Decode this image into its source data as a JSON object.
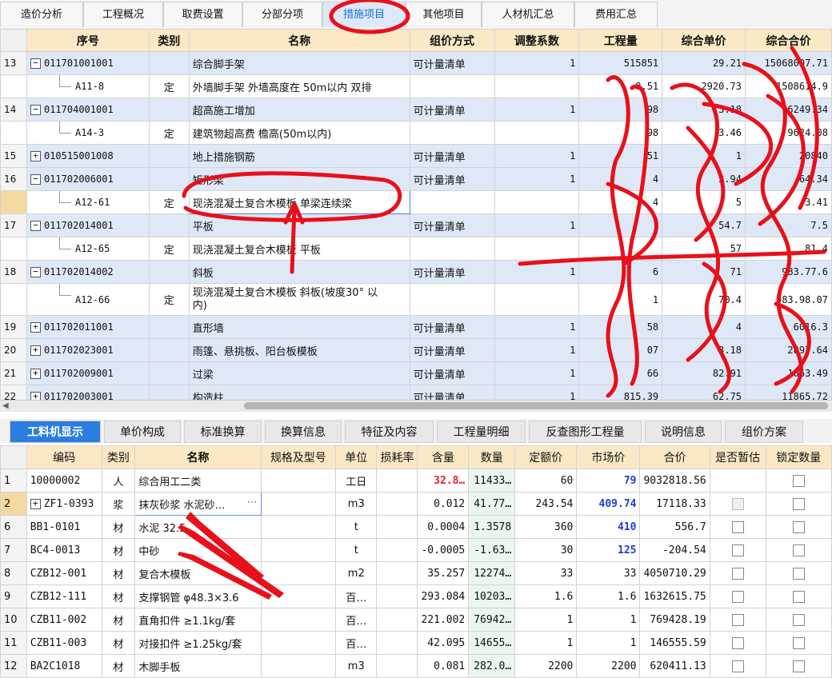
{
  "top_tabs": [
    "造价分析",
    "工程概况",
    "取费设置",
    "分部分项",
    "措施项目",
    "其他项目",
    "人材机汇总",
    "费用汇总"
  ],
  "active_top_tab": 4,
  "grid1": {
    "headers": [
      "序号",
      "类别",
      "名称",
      "组价方式",
      "调整系数",
      "工程量",
      "综合单价",
      "综合合价"
    ],
    "rows": [
      {
        "rn": "13",
        "exp": "−",
        "code": "011701001001",
        "type": "",
        "name": "综合脚手架",
        "method": "可计量清单",
        "coef": "1",
        "qty": "515851",
        "price": "29.21",
        "total": "15068007.71",
        "kind": "parent"
      },
      {
        "rn": "",
        "exp": "",
        "code": "A11-8",
        "type": "定",
        "name": "外墙脚手架 外墙高度在 50m以内 双排",
        "method": "",
        "coef": "",
        "qty": "8.51",
        "price": "2920.73",
        "total": "1508614.9",
        "kind": "child"
      },
      {
        "rn": "14",
        "exp": "−",
        "code": "011704001001",
        "type": "",
        "name": "超高施工增加",
        "method": "可计量清单",
        "coef": "1",
        "qty": "98",
        "price": "3.18",
        "total": "96249.34",
        "kind": "parent"
      },
      {
        "rn": "",
        "exp": "",
        "code": "A14-3",
        "type": "定",
        "name": "建筑物超高费 檐高(50m以内)",
        "method": "",
        "coef": "",
        "qty": "98",
        "price": "3.46",
        "total": "9624.08",
        "kind": "child"
      },
      {
        "rn": "15",
        "exp": "+",
        "code": "010515001008",
        "type": "",
        "name": "地上措施钢筋",
        "method": "可计量清单",
        "coef": "1",
        "qty": "51",
        "price": "1",
        "total": "20840",
        "kind": "parent"
      },
      {
        "rn": "16",
        "exp": "−",
        "code": "011702006001",
        "type": "",
        "name": "矩形梁",
        "method": "可计量清单",
        "coef": "1",
        "qty": "4",
        "price": "3.94",
        "total": "64.34",
        "kind": "parent"
      },
      {
        "rn": "",
        "exp": "",
        "code": "A12-61",
        "type": "定",
        "name": "现浇混凝土复合木模板 单梁连续梁",
        "method": "",
        "coef": "",
        "qty": "4",
        "price": "5",
        "total": "3.41",
        "kind": "sel"
      },
      {
        "rn": "17",
        "exp": "−",
        "code": "011702014001",
        "type": "",
        "name": "平板",
        "method": "可计量清单",
        "coef": "1",
        "qty": "",
        "price": "54.7",
        "total": "7.5",
        "kind": "parent"
      },
      {
        "rn": "",
        "exp": "",
        "code": "A12-65",
        "type": "定",
        "name": "现浇混凝土复合木模板 平板",
        "method": "",
        "coef": "",
        "qty": "",
        "price": "57",
        "total": "81.4",
        "kind": "child"
      },
      {
        "rn": "18",
        "exp": "−",
        "code": "011702014002",
        "type": "",
        "name": "斜板",
        "method": "可计量清单",
        "coef": "1",
        "qty": "6",
        "price": "71",
        "total": "983.77.6",
        "kind": "parent"
      },
      {
        "rn": "",
        "exp": "",
        "code": "A12-66",
        "type": "定",
        "name": "现浇混凝土复合木模板 斜板(坡度30° 以",
        "name2": "内)",
        "method": "",
        "coef": "",
        "qty": "1",
        "price": "70.4",
        "total": "983.98.07",
        "kind": "child",
        "tall": true
      },
      {
        "rn": "19",
        "exp": "+",
        "code": "011702011001",
        "type": "",
        "name": "直形墙",
        "method": "可计量清单",
        "coef": "1",
        "qty": "58",
        "price": "4",
        "total": "6016.3",
        "kind": "parent"
      },
      {
        "rn": "20",
        "exp": "+",
        "code": "011702023001",
        "type": "",
        "name": "雨篷、悬挑板、阳台板模板",
        "method": "可计量清单",
        "coef": "1",
        "qty": "07",
        "price": "3.18",
        "total": "2897.64",
        "kind": "parent"
      },
      {
        "rn": "21",
        "exp": "+",
        "code": "011702009001",
        "type": "",
        "name": "过梁",
        "method": "可计量清单",
        "coef": "1",
        "qty": "66",
        "price": "82.91",
        "total": "1063.49",
        "kind": "parent"
      },
      {
        "rn": "22",
        "exp": "+",
        "code": "011702003001",
        "type": "",
        "name": "构造柱",
        "method": "可计量清单",
        "coef": "1",
        "qty": "815.39",
        "price": "62.75",
        "total": "11865.72",
        "kind": "parent"
      }
    ]
  },
  "bottom_tabs": [
    "工料机显示",
    "单价构成",
    "标准换算",
    "换算信息",
    "特征及内容",
    "工程量明细",
    "反查图形工程量",
    "说明信息",
    "组价方案"
  ],
  "active_bottom_tab": 0,
  "grid2": {
    "headers": [
      "编码",
      "类别",
      "名称",
      "规格及型号",
      "单位",
      "损耗率",
      "含量",
      "数量",
      "定额价",
      "市场价",
      "合价",
      "是否暂估",
      "锁定数量"
    ],
    "rows": [
      {
        "rn": "1",
        "exp": "",
        "code": "10000002",
        "type": "人",
        "name": "综合用工二类",
        "spec": "",
        "unit": "工日",
        "loss": "",
        "content": "32.8…",
        "qty": "11433…",
        "base": "60",
        "market": "79",
        "total": "9032818.56",
        "est": "",
        "lock": "box",
        "content_red": true,
        "market_blue": true
      },
      {
        "rn": "2",
        "exp": "+",
        "code": "ZF1-0393",
        "type": "浆",
        "name": "抹灰砂浆 水泥砂…",
        "spec": "",
        "unit": "m3",
        "loss": "",
        "content": "0.012",
        "qty": "41.77…",
        "base": "243.54",
        "market": "409.74",
        "total": "17118.33",
        "est": "dis",
        "lock": "box",
        "market_blue": true,
        "sel": true
      },
      {
        "rn": "6",
        "exp": "",
        "code": "BB1-0101",
        "type": "材",
        "name": "水泥 32.5",
        "spec": "",
        "unit": "t",
        "loss": "",
        "content": "0.0004",
        "qty": "1.3578",
        "base": "360",
        "market": "410",
        "total": "556.7",
        "est": "box",
        "lock": "box",
        "market_blue": true
      },
      {
        "rn": "7",
        "exp": "",
        "code": "BC4-0013",
        "type": "材",
        "name": "中砂",
        "spec": "",
        "unit": "t",
        "loss": "",
        "content": "-0.0005",
        "qty": "-1.63…",
        "base": "30",
        "market": "125",
        "total": "-204.54",
        "est": "box",
        "lock": "box",
        "market_blue": true
      },
      {
        "rn": "8",
        "exp": "",
        "code": "CZB12-001",
        "type": "材",
        "name": "复合木模板",
        "spec": "",
        "unit": "m2",
        "loss": "",
        "content": "35.257",
        "qty": "12274…",
        "base": "33",
        "market": "33",
        "total": "4050710.29",
        "est": "box",
        "lock": "box"
      },
      {
        "rn": "9",
        "exp": "",
        "code": "CZB12-111",
        "type": "材",
        "name": "支撑钢管 φ48.3×3.6",
        "spec": "",
        "unit": "百…",
        "loss": "",
        "content": "293.084",
        "qty": "10203…",
        "base": "1.6",
        "market": "1.6",
        "total": "1632615.75",
        "est": "box",
        "lock": "box"
      },
      {
        "rn": "10",
        "exp": "",
        "code": "CZB11-002",
        "type": "材",
        "name": "直角扣件 ≥1.1kg/套",
        "spec": "",
        "unit": "百…",
        "loss": "",
        "content": "221.002",
        "qty": "76942…",
        "base": "1",
        "market": "1",
        "total": "769428.19",
        "est": "box",
        "lock": "box"
      },
      {
        "rn": "11",
        "exp": "",
        "code": "CZB11-003",
        "type": "材",
        "name": "对接扣件 ≥1.25kg/套",
        "spec": "",
        "unit": "百…",
        "loss": "",
        "content": "42.095",
        "qty": "14655…",
        "base": "1",
        "market": "1",
        "total": "146555.59",
        "est": "box",
        "lock": "box"
      },
      {
        "rn": "12",
        "exp": "",
        "code": "BA2C1018",
        "type": "材",
        "name": "木脚手板",
        "spec": "",
        "unit": "m3",
        "loss": "",
        "content": "0.081",
        "qty": "282.0…",
        "base": "2200",
        "market": "2200",
        "total": "620411.13",
        "est": "box",
        "lock": "box"
      }
    ]
  },
  "colors": {
    "annotation_red": "#e8101a",
    "header_bg": "#fbe9c6",
    "active_tab_bg": "#2b7de0"
  }
}
